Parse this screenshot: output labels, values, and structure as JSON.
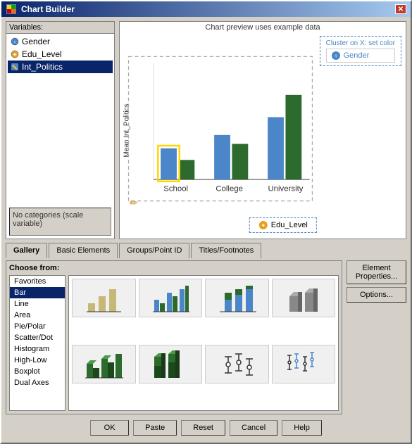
{
  "window": {
    "title": "Chart Builder",
    "close_btn": "✕"
  },
  "variables": {
    "label": "Variables:",
    "items": [
      {
        "name": "Gender",
        "type": "nominal",
        "color": "#4a86c8"
      },
      {
        "name": "Edu_Level",
        "type": "ordinal",
        "color": "#e8a020"
      },
      {
        "name": "Int_Politics",
        "type": "scale",
        "color": "#4a86c8"
      }
    ],
    "no_categories": "No categories (scale\nvariable)"
  },
  "preview": {
    "label": "Chart preview uses example data",
    "cluster_label": "Cluster on X: set color",
    "cluster_var": "Gender",
    "x_axis_var": "Edu_Level",
    "y_axis_label": "Mean\nInt_Politics",
    "x_ticks": [
      "School",
      "College",
      "University"
    ]
  },
  "tabs": [
    {
      "id": "gallery",
      "label": "Gallery",
      "active": true
    },
    {
      "id": "basic-elements",
      "label": "Basic Elements",
      "active": false
    },
    {
      "id": "groups-point-id",
      "label": "Groups/Point ID",
      "active": false
    },
    {
      "id": "titles-footnotes",
      "label": "Titles/Footnotes",
      "active": false
    }
  ],
  "gallery": {
    "choose_from_label": "Choose from:",
    "chart_types": [
      {
        "id": "favorites",
        "label": "Favorites"
      },
      {
        "id": "bar",
        "label": "Bar",
        "selected": true
      },
      {
        "id": "line",
        "label": "Line"
      },
      {
        "id": "area",
        "label": "Area"
      },
      {
        "id": "pie-polar",
        "label": "Pie/Polar"
      },
      {
        "id": "scatter-dot",
        "label": "Scatter/Dot"
      },
      {
        "id": "histogram",
        "label": "Histogram"
      },
      {
        "id": "high-low",
        "label": "High-Low"
      },
      {
        "id": "boxplot",
        "label": "Boxplot"
      },
      {
        "id": "dual-axes",
        "label": "Dual Axes"
      }
    ]
  },
  "right_buttons": {
    "element_properties": "Element\nProperties...",
    "options": "Options..."
  },
  "footer_buttons": {
    "ok": "OK",
    "paste": "Paste",
    "reset": "Reset",
    "cancel": "Cancel",
    "help": "Help"
  }
}
